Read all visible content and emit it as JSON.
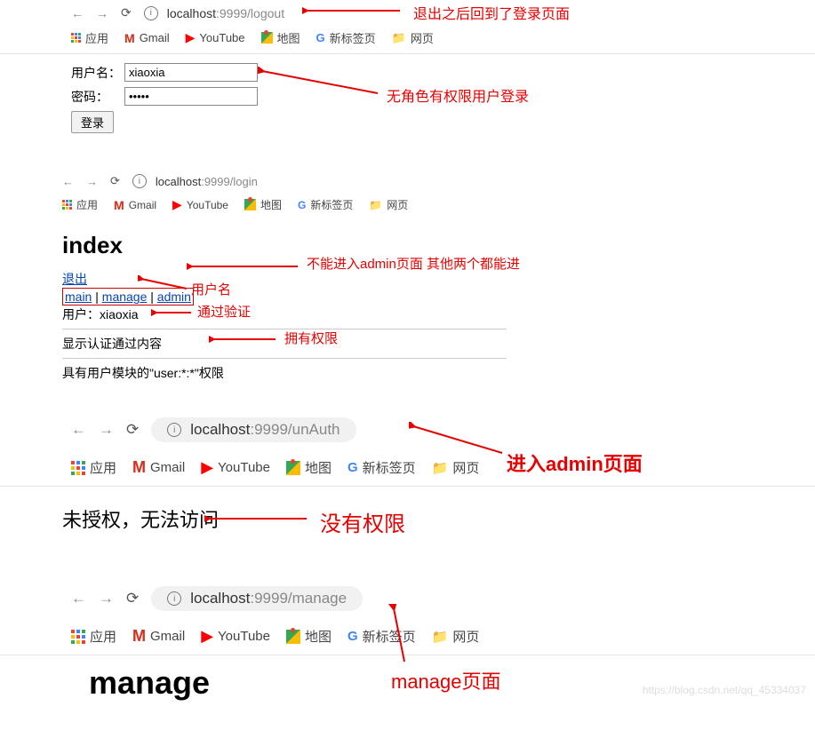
{
  "s1": {
    "url_host": "localhost",
    "url_port": ":9999",
    "url_path": "/logout",
    "bm": {
      "apps": "应用",
      "gmail": "Gmail",
      "youtube": "YouTube",
      "maps": "地图",
      "newtab": "新标签页",
      "web": "网页"
    },
    "form": {
      "lbl_user": "用户名：",
      "lbl_pwd": "密码：",
      "val_user": "xiaoxia",
      "val_pwd": "•••••",
      "btn": "登录"
    },
    "ann_url": "退出之后回到了登录页面",
    "ann_login": "无角色有权限用户登录"
  },
  "s2": {
    "url_host": "localhost",
    "url_port": ":9999",
    "url_path": "/login",
    "bm": {
      "apps": "应用",
      "gmail": "Gmail",
      "youtube": "YouTube",
      "maps": "地图",
      "newtab": "新标签页",
      "web": "网页"
    },
    "heading": "index",
    "logout": "退出",
    "link_main": "main",
    "link_manage": "manage",
    "link_admin": "admin",
    "link_sep": " | ",
    "user_line_lbl": "用户：",
    "user_line_val": "xiaoxia",
    "auth_line": "显示认证通过内容",
    "perm_line": "具有用户模块的\"user:*:*\"权限",
    "ann_links": "不能进入admin页面 其他两个都能进",
    "ann_user": "用户名",
    "ann_auth": "通过验证",
    "ann_perm": "拥有权限"
  },
  "s3": {
    "url_host": "localhost",
    "url_port": ":9999",
    "url_path": "/unAuth",
    "bm": {
      "apps": "应用",
      "gmail": "Gmail",
      "youtube": "YouTube",
      "maps": "地图",
      "newtab": "新标签页",
      "web": "网页"
    },
    "msg": "未授权，无法访问",
    "ann_enter": "进入admin页面",
    "ann_noperm": "没有权限"
  },
  "s4": {
    "url_host": "localhost",
    "url_port": ":9999",
    "url_path": "/manage",
    "bm": {
      "apps": "应用",
      "gmail": "Gmail",
      "youtube": "YouTube",
      "maps": "地图",
      "newtab": "新标签页",
      "web": "网页"
    },
    "heading": "manage",
    "ann": "manage页面"
  },
  "watermark": "https://blog.csdn.net/qq_45334037"
}
